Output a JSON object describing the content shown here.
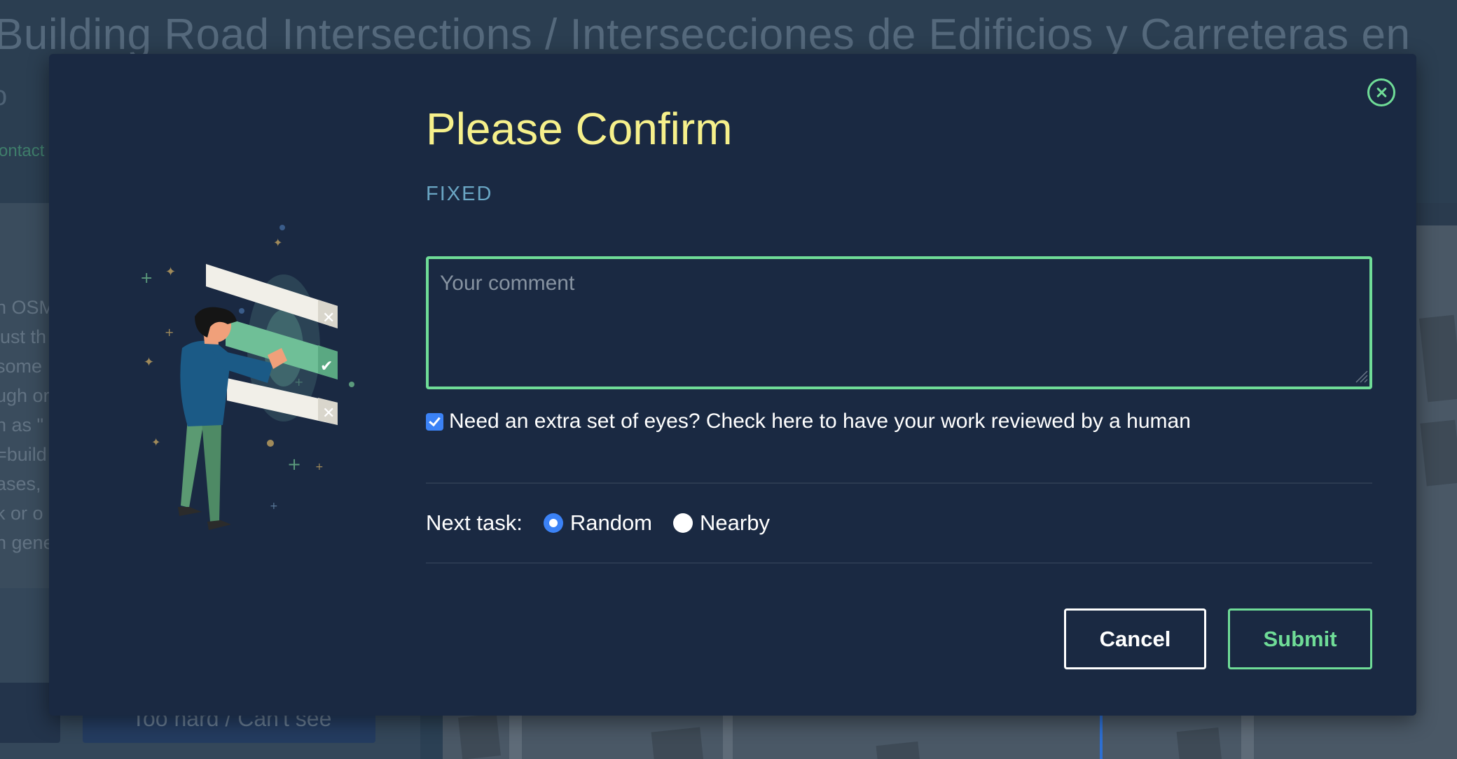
{
  "background": {
    "challenge_title": "Building Road Intersections / Intersecciones de Edificios y Carreteras en",
    "subtitle_fragment": "o",
    "contact_fragment": "ontact",
    "description_lines": [
      "n OSM",
      "just th",
      "some ",
      "ugh or",
      "h as \"",
      "=build",
      "ases,",
      "k or o",
      "n gene"
    ],
    "too_hard_button": "Too hard / Can't see"
  },
  "modal": {
    "title": "Please Confirm",
    "status": "FIXED",
    "comment_placeholder": "Your comment",
    "comment_value": "",
    "review_request": {
      "checked": true,
      "label": "Need an extra set of eyes? Check here to have your work reviewed by a human"
    },
    "next_task": {
      "label": "Next task:",
      "options": [
        {
          "label": "Random",
          "selected": true
        },
        {
          "label": "Nearby",
          "selected": false
        }
      ]
    },
    "cancel_label": "Cancel",
    "submit_label": "Submit"
  },
  "colors": {
    "modal_bg": "#1a2942",
    "accent_green": "#6fdc97",
    "title_yellow": "#f6f08b",
    "status_blue": "#6aa6c4",
    "check_blue": "#3b82f6"
  },
  "icons": {
    "close": "close-circle-icon",
    "illustration": "person-reviewing-checklist"
  }
}
